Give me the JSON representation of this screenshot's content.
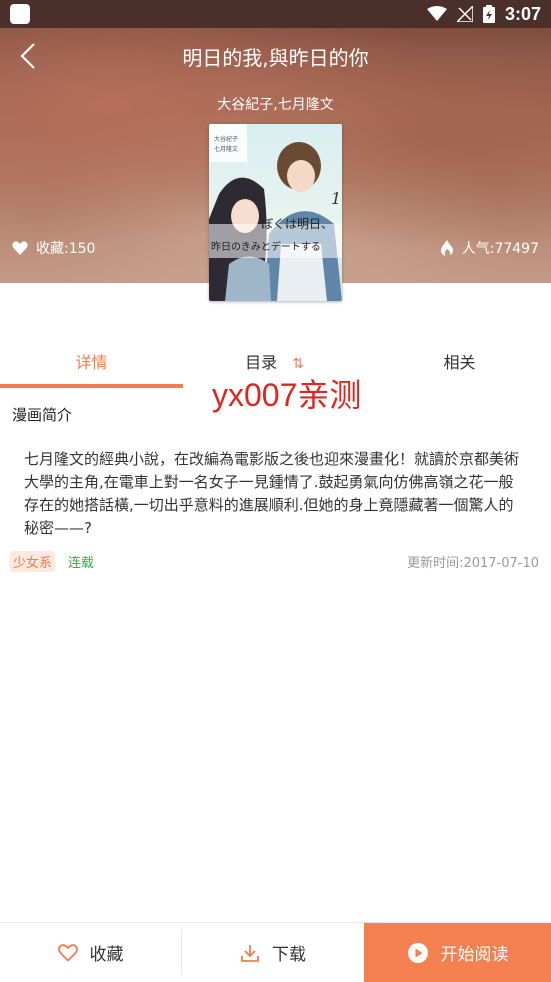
{
  "status_bar": {
    "time": "3:07"
  },
  "header": {
    "title": "明日的我,與昨日的你",
    "authors": "大谷紀子,七月隆文",
    "favorites": "收藏:150",
    "popularity": "人气:77497"
  },
  "cover": {
    "volume": "1",
    "title_line1": "ぼくは明日、",
    "title_line2": "昨日のきみとデートする",
    "credit1": "大谷紀子",
    "credit2": "七月隆文"
  },
  "tabs": [
    {
      "label": "详情"
    },
    {
      "label": "目录"
    },
    {
      "label": "相关"
    }
  ],
  "watermark": "yx007亲测",
  "intro": {
    "heading": "漫画简介",
    "text": "七月隆文的經典小說，在改編為電影版之後也迎來漫畫化！就讀於京都美術大學的主角,在電車上對一名女子一見鍾情了.鼓起勇氣向仿佛高嶺之花一般存在的她搭話橫,一切出乎意料的進展順利.但她的身上竟隱藏著一個驚人的秘密——?"
  },
  "tags": [
    "少女系",
    "连载"
  ],
  "update": "更新时间:2017-07-10",
  "bottom_bar": {
    "favorite": "收藏",
    "download": "下载",
    "read": "开始阅读"
  },
  "colors": {
    "accent": "#f47c4a",
    "green": "#2eac4a"
  }
}
